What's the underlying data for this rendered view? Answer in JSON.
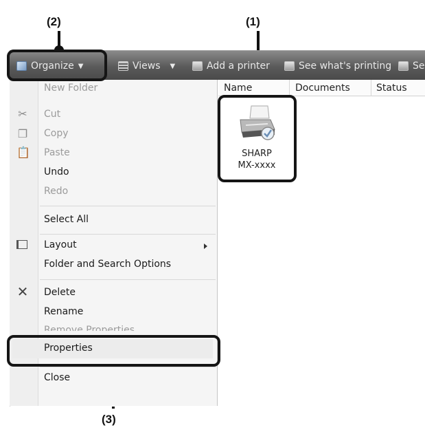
{
  "callouts": {
    "one": "(1)",
    "two": "(2)",
    "three": "(3)"
  },
  "toolbar": {
    "organize": "Organize",
    "views": "Views",
    "add_printer": "Add a printer",
    "see_printing": "See what's printing",
    "select_prefs": "Sel"
  },
  "menu": {
    "new_folder": "New Folder",
    "cut": "Cut",
    "copy": "Copy",
    "paste": "Paste",
    "undo": "Undo",
    "redo": "Redo",
    "select_all": "Select All",
    "layout": "Layout",
    "folder_options": "Folder and Search Options",
    "delete": "Delete",
    "rename": "Rename",
    "remove_properties": "Remove Properties",
    "properties": "Properties",
    "close": "Close"
  },
  "list": {
    "columns": [
      "Name",
      "Documents",
      "Status"
    ]
  },
  "printer": {
    "line1": "SHARP",
    "line2": "MX-xxxx"
  },
  "colors": {
    "toolbar": "#5a5a5a",
    "menu_bg": "#f5f5f5",
    "highlight": "#151515"
  }
}
